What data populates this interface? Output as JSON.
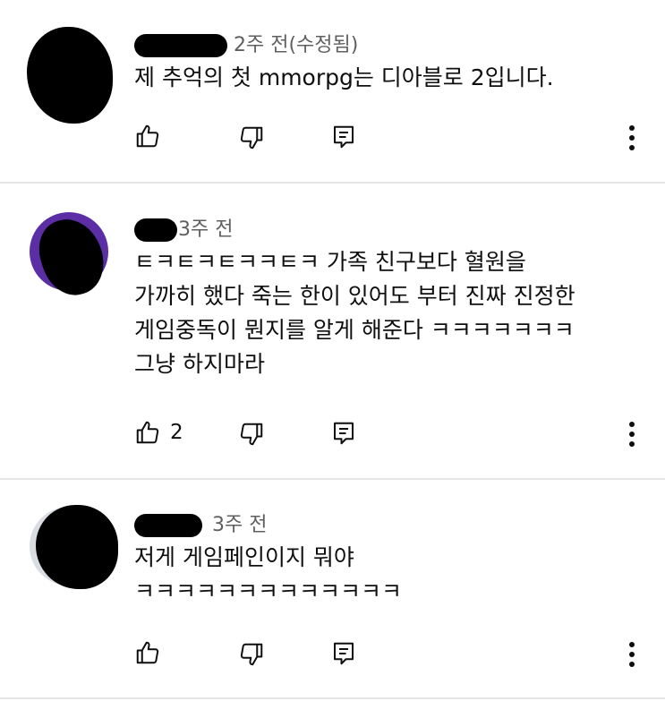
{
  "comments": [
    {
      "time": "2주 전(수정됨)",
      "lines": [
        "제 추억의 첫 mmorpg는 디아블로 2입니다."
      ],
      "likes": "",
      "avatar_color": "#8fc3e3"
    },
    {
      "time": "3주 전",
      "lines": [
        "ㅌㅋㅌㅋㅌㅋㅋㅌㅋ 가족 친구보다 혈원을",
        "가까히 했다 죽는 한이 있어도 부터 진짜 진정한",
        "게임중독이 뭔지를 알게 해준다 ㅋㅋㅋㅋㅋㅋㅋ",
        "그냥 하지마라"
      ],
      "likes": "2",
      "avatar_color": "#5b2ea6"
    },
    {
      "time": "3주 전",
      "lines": [
        "저게 게임페인이지 뭐야",
        "ㅋㅋㅋㅋㅋㅋㅋㅋㅋㅋㅋㅋㅋ"
      ],
      "likes": "",
      "avatar_color": "#d9dde3"
    }
  ],
  "icons": {
    "like": "thumbs-up-icon",
    "dislike": "thumbs-down-icon",
    "reply": "reply-icon",
    "more": "more-vert-icon"
  }
}
